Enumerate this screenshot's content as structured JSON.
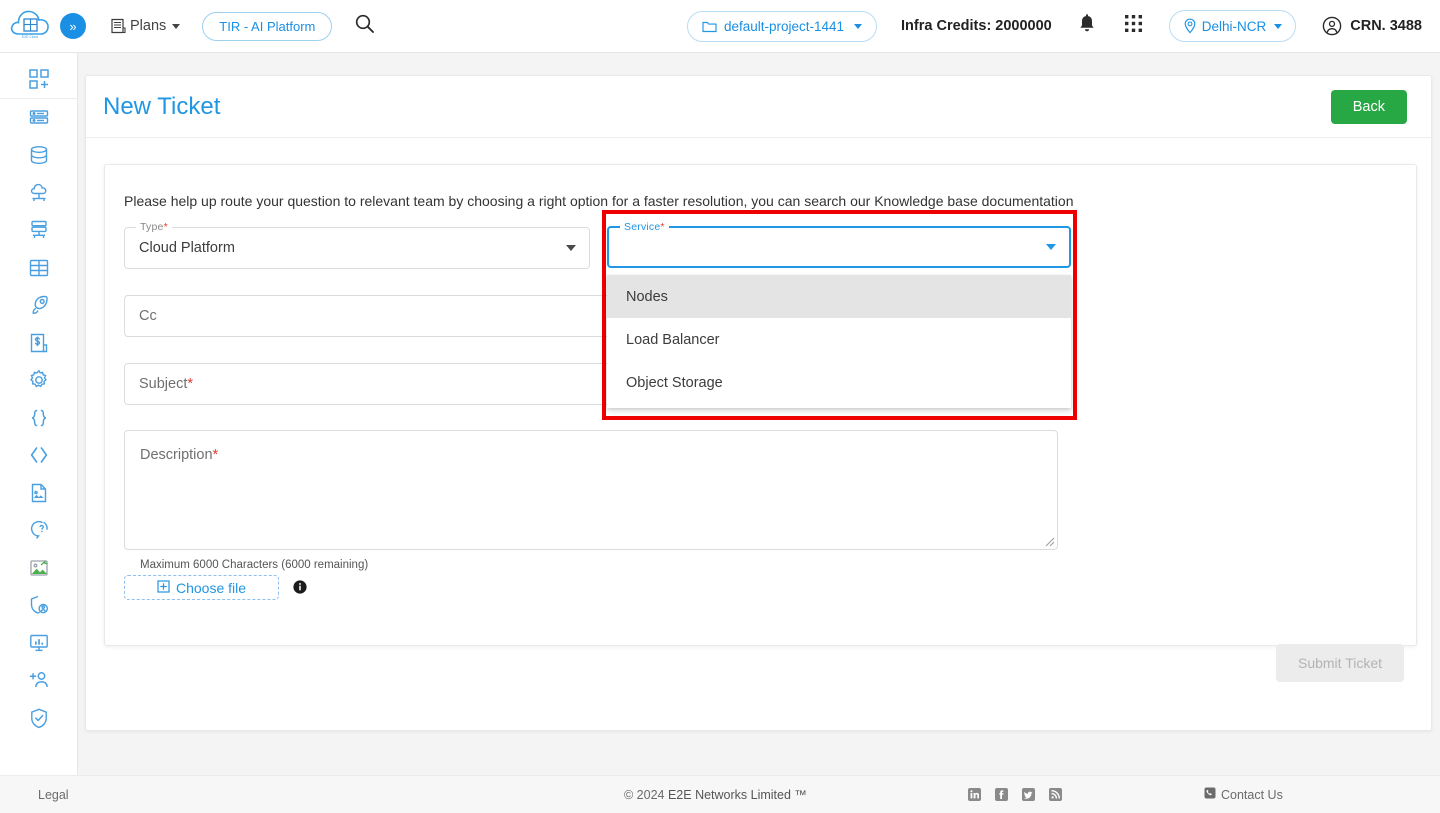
{
  "topbar": {
    "logo_icon": "cloud-grid-logo-icon",
    "logo_caption": "E2E Cloud",
    "toggle_icon": "expand-chevrons-icon",
    "plans_label": "Plans",
    "plans_icon": "invoice-icon",
    "tir_label": "TIR - AI Platform",
    "search_icon": "search-icon",
    "project_label": "default-project-1441",
    "project_icon": "folder-icon",
    "credits_label": "Infra Credits: 2000000",
    "bell_icon": "bell-icon",
    "apps_icon": "apps-grid-icon",
    "region_label": "Delhi-NCR",
    "region_icon": "location-pin-icon",
    "crn_label": "CRN. 3488",
    "account_icon": "user-circle-icon"
  },
  "sidebar": {
    "items": [
      {
        "name": "sidebar-item-add-dashboard",
        "icon": "grid-plus-icon"
      },
      {
        "name": "sidebar-item-compute",
        "icon": "server-rack-icon"
      },
      {
        "name": "sidebar-item-database",
        "icon": "database-icon"
      },
      {
        "name": "sidebar-item-cloud-upload",
        "icon": "cloud-network-icon"
      },
      {
        "name": "sidebar-item-network",
        "icon": "server-network-icon"
      },
      {
        "name": "sidebar-item-storage-grid",
        "icon": "storage-grid-icon"
      },
      {
        "name": "sidebar-item-launch",
        "icon": "rocket-icon"
      },
      {
        "name": "sidebar-item-billing",
        "icon": "invoice-dollar-icon"
      },
      {
        "name": "sidebar-item-settings",
        "icon": "gear-icon"
      },
      {
        "name": "sidebar-item-api",
        "icon": "curly-braces-icon"
      },
      {
        "name": "sidebar-item-code",
        "icon": "angle-brackets-icon"
      },
      {
        "name": "sidebar-item-documents",
        "icon": "document-image-icon"
      },
      {
        "name": "sidebar-item-support",
        "icon": "question-chat-icon"
      },
      {
        "name": "sidebar-item-images",
        "icon": "image-export-icon"
      },
      {
        "name": "sidebar-item-identity",
        "icon": "shield-user-icon"
      },
      {
        "name": "sidebar-item-monitoring",
        "icon": "monitor-chart-icon"
      },
      {
        "name": "sidebar-item-add-user",
        "icon": "user-plus-icon"
      },
      {
        "name": "sidebar-item-security",
        "icon": "shield-check-icon"
      }
    ]
  },
  "page": {
    "title": "New Ticket",
    "back_label": "Back",
    "helper_text": "Please help up route your question to relevant team by choosing a right option for a faster resolution, you can search our Knowledge base documentation"
  },
  "form": {
    "type": {
      "label": "Type",
      "required": "*",
      "value": "Cloud Platform",
      "arrow_icon": "chevron-down-icon"
    },
    "service": {
      "label": "Service",
      "required": "*",
      "value": "",
      "arrow_icon": "chevron-down-icon",
      "options": [
        "Nodes",
        "Load Balancer",
        "Object Storage"
      ],
      "highlighted_option": "Nodes"
    },
    "cc": {
      "placeholder": "Cc"
    },
    "subject": {
      "placeholder": "Subject",
      "required": "*"
    },
    "description": {
      "placeholder": "Description",
      "required": "*",
      "char_note": "Maximum 6000 Characters (6000 remaining)"
    },
    "choose_file": {
      "label": "Choose file",
      "icon": "plus-box-icon"
    },
    "info_icon": "info-icon",
    "submit_label": "Submit Ticket"
  },
  "footer": {
    "legal": "Legal",
    "copyright": "© 2024 ",
    "brand": "E2E Networks Limited ™",
    "social": [
      {
        "name": "linkedin-icon",
        "glyph": "in"
      },
      {
        "name": "facebook-icon",
        "glyph": "f"
      },
      {
        "name": "twitter-icon",
        "glyph": "t"
      },
      {
        "name": "rss-icon",
        "glyph": "r"
      }
    ],
    "contact_label": "Contact Us",
    "contact_icon": "phone-icon"
  },
  "colors": {
    "accent_blue": "#2196e3",
    "sidebar_icon": "#4a9fe0",
    "green_button": "#28a745",
    "highlight_red": "#ef0000",
    "required_red": "#e03b2f"
  }
}
